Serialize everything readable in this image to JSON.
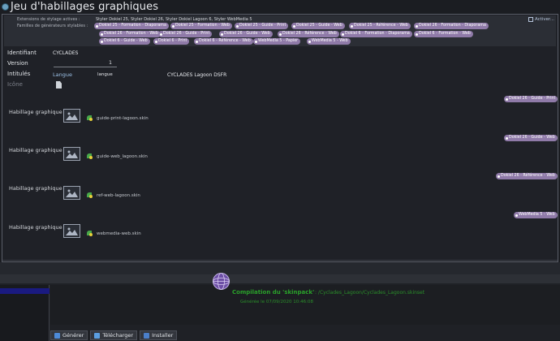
{
  "window": {
    "title": "Jeu d'habillages graphiques"
  },
  "extensions": {
    "label": "Extensions de stylage actives :",
    "value": "Styler Dokiel 25, Styler Dokiel 26, Styler Dokiel Lagoon 6, Styler WebMedia 5",
    "families_label": "Familles de générateurs stylables :",
    "activate_label": "Activer...",
    "families": [
      "Dokiel 25 - Formation - Diaporama",
      "Dokiel 25 - Formation - Web",
      "Dokiel 25 - Guide - Print",
      "Dokiel 25 - Guide - Web",
      "Dokiel 25 - Référence - Web",
      "Dokiel 26 - Formation - Diaporama",
      "Dokiel 26 - Formation - Web",
      "Dokiel 26 - Guide - Print",
      "Dokiel 26 - Guide - Web",
      "Dokiel 26 - Référence - Web",
      "Dokiel 6 - Formation - Diaporama",
      "Dokiel 6 - Formation - Web",
      "Dokiel 6 - Guide - Web",
      "Dokiel 6 - Print",
      "Dokiel 6 - Référence - Web",
      "WebMedia 5 - Papier",
      "WebMedia 5 - Web"
    ]
  },
  "form": {
    "identifiant_label": "Identifiant",
    "identifiant_value": "CYCLADES",
    "version_label": "Version",
    "version_value": "1",
    "intitules_label": "Intitulés",
    "langue_label": "Langue",
    "langue_placeholder": "langue",
    "intitule_value": "CYCLADES Lagoon DSFR",
    "icone_label": "Icône"
  },
  "skins": [
    {
      "label": "Habillage graphique",
      "file": "guide-print-lagoon.skin",
      "tag": "Dokiel 26 - Guide - Print"
    },
    {
      "label": "Habillage graphique",
      "file": "guide-web_lagoon.skin",
      "tag": "Dokiel 26 - Guide - Web"
    },
    {
      "label": "Habillage graphique",
      "file": "ref-web-lagoon.skin",
      "tag": "Dokiel 26 - Référence - Web"
    },
    {
      "label": "Habillage graphique",
      "file": "webmedia-web.skin",
      "tag": "WebMedia 5 - Web"
    }
  ],
  "build": {
    "title": "Compilation du 'skinpack'",
    "path": ": /Cyclades_Lagoon/Cyclades_Lagoon.skinset",
    "date": "Générée le 07/09/2020 10:46:08"
  },
  "toolbar": {
    "generate_label": "Générer",
    "download_label": "Télécharger",
    "install_label": "Installer"
  },
  "colors": {
    "tag": "#8f7aa8",
    "success": "#2aa12a",
    "selection": "#1a1a80"
  }
}
